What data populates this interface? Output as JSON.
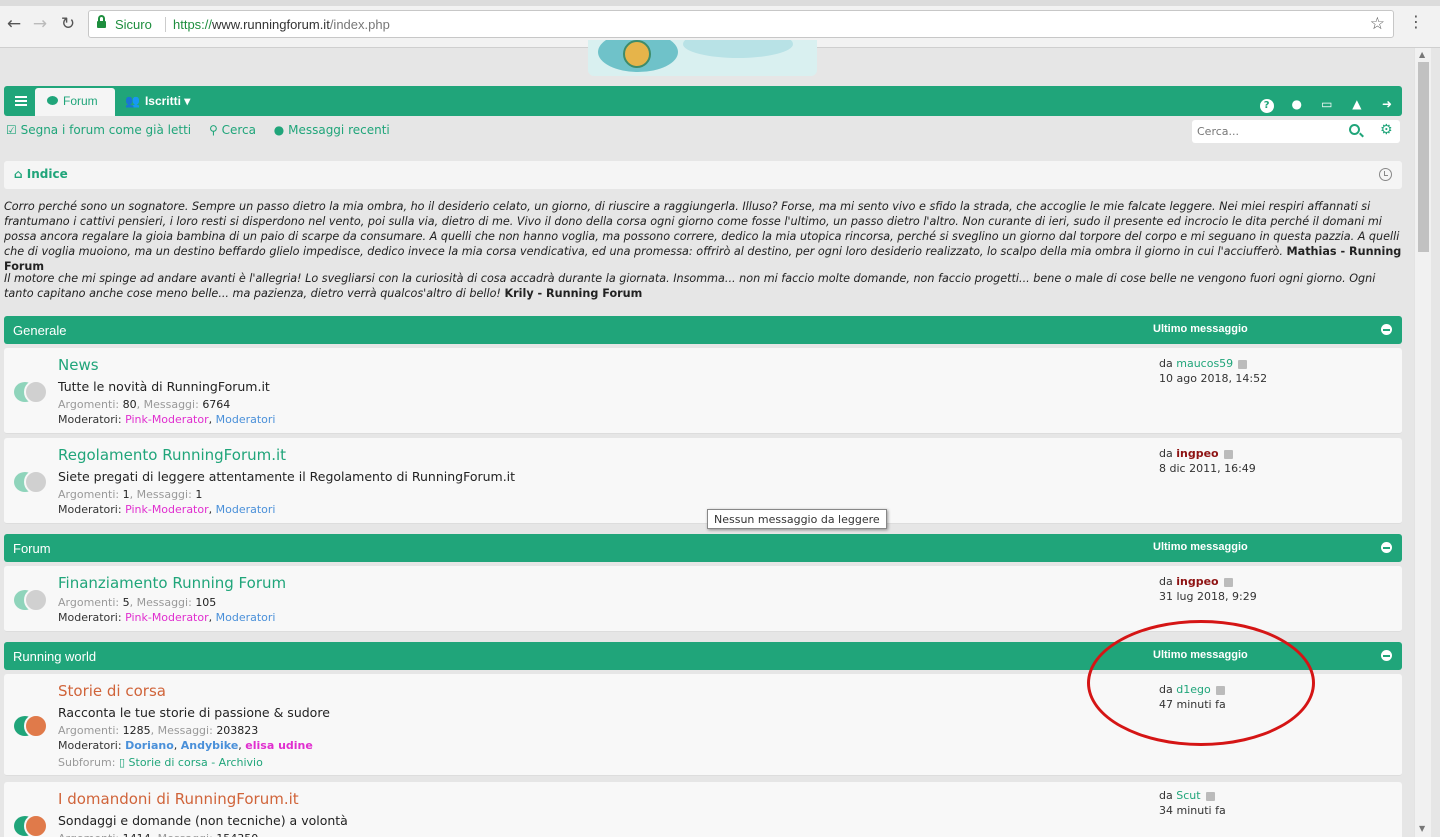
{
  "browser": {
    "secure_label": "Sicuro",
    "url_scheme": "https://",
    "url_host": "www.runningforum.it",
    "url_path": "/index.php"
  },
  "navbar": {
    "forum_tab": "Forum",
    "members_tab": "Iscritti"
  },
  "quicklinks": {
    "mark_read": "Segna i forum come già letti",
    "search": "Cerca",
    "recent": "Messaggi recenti"
  },
  "search": {
    "placeholder": "Cerca..."
  },
  "breadcrumb": {
    "home": "Indice"
  },
  "quotes": [
    {
      "text": "Corro perché sono un sognatore. Sempre un passo dietro la mia ombra, ho il desiderio celato, un giorno, di riuscire a raggiungerla. Illuso? Forse, ma mi sento vivo e sfido la strada, che accoglie le mie falcate leggere. Nei miei respiri affannati si frantumano i cattivi pensieri, i loro resti si disperdono nel vento, poi sulla via, dietro di me. Vivo il dono della corsa ogni giorno come fosse l'ultimo, un passo dietro l'altro. Non curante di ieri, sudo il presente ed incrocio le dita perché il domani mi possa ancora regalare la gioia bambina di un paio di scarpe da consumare. A quelli che non hanno voglia, ma possono correre, dedico la mia utopica rincorsa, perché si sveglino un giorno dal torpore del corpo e mi seguano in questa pazzia. A quelli che di voglia muoiono, ma un destino beffardo glielo impedisce, dedico invece la mia corsa vendicativa, ed una promessa: offrirò al destino, per ogni loro desiderio realizzato, lo scalpo della mia ombra il giorno in cui l'acciufferò.",
      "author": "Mathias - Running Forum"
    },
    {
      "text": "Il motore che mi spinge ad andare avanti è l'allegria! Lo svegliarsi con la curiosità di cosa accadrà durante la giornata. Insomma... non mi faccio molte domande, non faccio progetti... bene o male di cose belle ne vengono fuori ogni giorno. Ogni tanto capitano anche cose meno belle... ma pazienza, dietro verrà qualcos'altro di bello!",
      "author": "Krily - Running Forum"
    }
  ],
  "labels": {
    "last_post": "Ultimo messaggio",
    "by": "da",
    "topics": "Argomenti:",
    "posts": "Messaggi:",
    "moderators": "Moderatori:",
    "subforum": "Subforum:"
  },
  "categories": {
    "generale": "Generale",
    "forum": "Forum",
    "running_world": "Running world"
  },
  "forums": {
    "news": {
      "title": "News",
      "desc": "Tutte le novità di RunningForum.it",
      "topics": "80",
      "posts": "6764",
      "mod1": "Pink-Moderator",
      "mod2": "Moderatori",
      "last_author": "maucos59",
      "last_date": "10 ago 2018, 14:52"
    },
    "regolamento": {
      "title": "Regolamento RunningForum.it",
      "desc": "Siete pregati di leggere attentamente il Regolamento di RunningForum.it",
      "topics": "1",
      "posts": "1",
      "mod1": "Pink-Moderator",
      "mod2": "Moderatori",
      "last_author": "ingpeo",
      "last_date": "8 dic 2011, 16:49"
    },
    "finanziamento": {
      "title": "Finanziamento Running Forum",
      "topics": "5",
      "posts": "105",
      "mod1": "Pink-Moderator",
      "mod2": "Moderatori",
      "last_author": "ingpeo",
      "last_date": "31 lug 2018, 9:29"
    },
    "storie": {
      "title": "Storie di corsa",
      "desc": "Racconta le tue storie di passione & sudore",
      "topics": "1285",
      "posts": "203823",
      "mod1": "Doriano",
      "mod2": "Andybike",
      "mod3": "elisa udine",
      "subforum": "Storie di corsa - Archivio",
      "last_author": "d1ego",
      "last_date": "47 minuti fa"
    },
    "domandoni": {
      "title": "I domandoni di RunningForum.it",
      "desc": "Sondaggi e domande (non tecniche) a volontà",
      "topics": "1414",
      "posts": "154350",
      "last_author": "Scut",
      "last_date": "34 minuti fa"
    }
  },
  "tooltip": "Nessun messaggio da leggere",
  "colors": {
    "brand": "#20a57a",
    "annotation": "#d51515",
    "unread_icon": "#e07a4a"
  }
}
